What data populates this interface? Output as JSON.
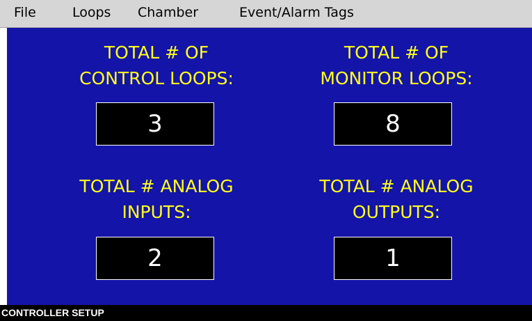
{
  "menu": {
    "file": "File",
    "loops": "Loops",
    "chamber": "Chamber",
    "event_alarm_tags": "Event/Alarm Tags"
  },
  "setup": {
    "control_loops": {
      "label_line1": "TOTAL # OF",
      "label_line2": "CONTROL LOOPS:",
      "value": "3"
    },
    "monitor_loops": {
      "label_line1": "TOTAL # OF",
      "label_line2": "MONITOR LOOPS:",
      "value": "8"
    },
    "analog_inputs": {
      "label_line1": "TOTAL # ANALOG",
      "label_line2": "INPUTS:",
      "value": "2"
    },
    "analog_outputs": {
      "label_line1": "TOTAL # ANALOG",
      "label_line2": "OUTPUTS:",
      "value": "1"
    }
  },
  "status_bar": {
    "text": "CONTROLLER SETUP"
  },
  "colors": {
    "background_blue": "#1414a8",
    "label_yellow": "#ffff1e",
    "value_box_black": "#000000",
    "menubar_gray": "#d6d6d6"
  }
}
